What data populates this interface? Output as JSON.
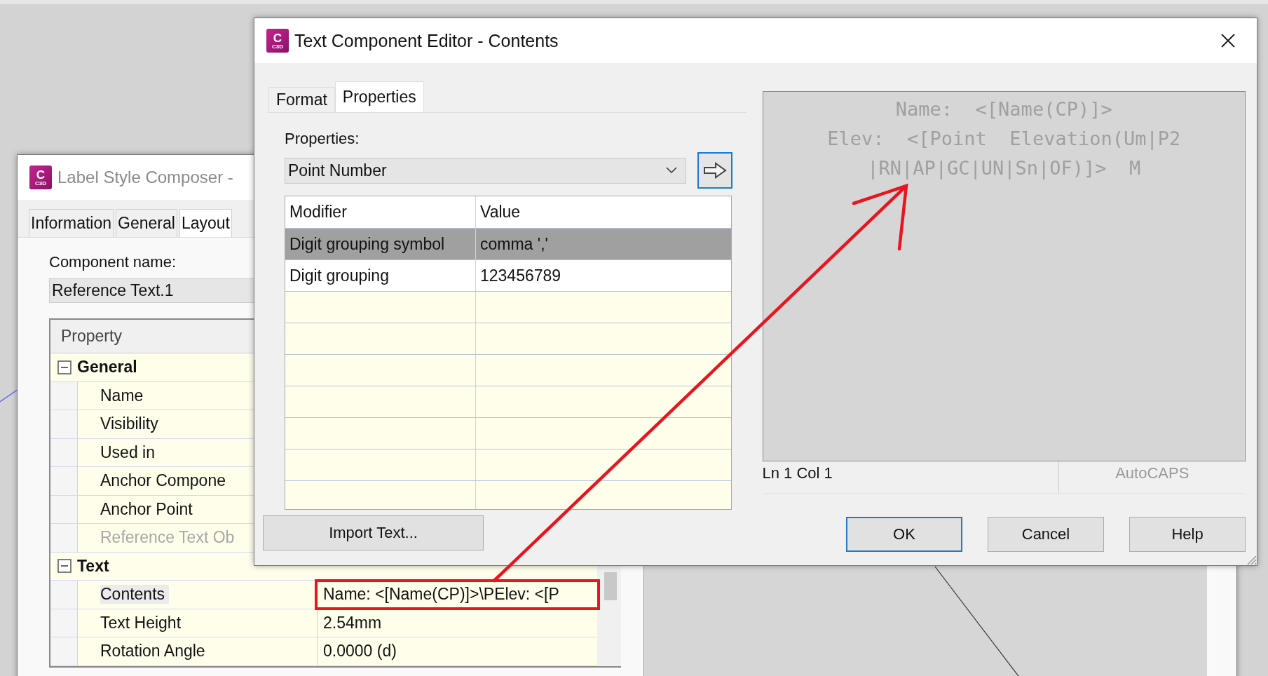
{
  "background_window": {
    "title": "Label Style Composer -",
    "app_icon": {
      "letter": "C",
      "badge": "C3D"
    },
    "tabs": [
      {
        "label": "Information",
        "selected": false
      },
      {
        "label": "General",
        "selected": false
      },
      {
        "label": "Layout",
        "selected": true
      }
    ],
    "component_name_label": "Component name:",
    "component_name": "Reference Text.1",
    "property_grid": {
      "header": "Property",
      "groups": [
        {
          "label": "General",
          "expanded": true,
          "rows": [
            {
              "property": "Name",
              "disabled": false,
              "selected": false
            },
            {
              "property": "Visibility",
              "disabled": false,
              "selected": false
            },
            {
              "property": "Used in",
              "disabled": false,
              "selected": false
            },
            {
              "property": "Anchor Compone",
              "disabled": false,
              "selected": false
            },
            {
              "property": "Anchor Point",
              "disabled": false,
              "selected": false
            },
            {
              "property": "Reference Text Ob",
              "disabled": true,
              "selected": false
            }
          ]
        },
        {
          "label": "Text",
          "expanded": true,
          "rows": [
            {
              "property": "Contents",
              "value": "Name: <[Name(CP)]>\\PElev: <[P",
              "disabled": false,
              "selected": true,
              "highlighted": true
            },
            {
              "property": "Text Height",
              "value": "2.54mm",
              "disabled": false,
              "selected": false,
              "highlighted": false
            },
            {
              "property": "Rotation Angle",
              "value": "0.0000 (d)",
              "disabled": false,
              "selected": false,
              "highlighted": false
            }
          ]
        }
      ]
    }
  },
  "dialog": {
    "title": "Text Component Editor - Contents",
    "app_icon": {
      "letter": "C",
      "badge": "C3D"
    },
    "tabs": [
      {
        "label": "Format",
        "selected": false
      },
      {
        "label": "Properties",
        "selected": true
      }
    ],
    "properties_label": "Properties:",
    "properties_select": "Point Number",
    "modifier_table": {
      "columns": [
        "Modifier",
        "Value"
      ],
      "rows": [
        {
          "modifier": "Digit grouping symbol",
          "value": "comma ','",
          "selected": true
        },
        {
          "modifier": "Digit grouping",
          "value": "123456789",
          "selected": false
        }
      ]
    },
    "import_button": "Import Text...",
    "preview_lines": [
      "Name:  <[Name(CP)]>",
      "Elev:  <[Point  Elevation(Um|P2",
      "|RN|AP|GC|UN|Sn|OF)]>  M"
    ],
    "status": {
      "position": "Ln 1 Col 1",
      "mode": "AutoCAPS"
    },
    "buttons": [
      {
        "label": "OK",
        "default": true
      },
      {
        "label": "Cancel",
        "default": false
      },
      {
        "label": "Help",
        "default": false
      }
    ]
  }
}
